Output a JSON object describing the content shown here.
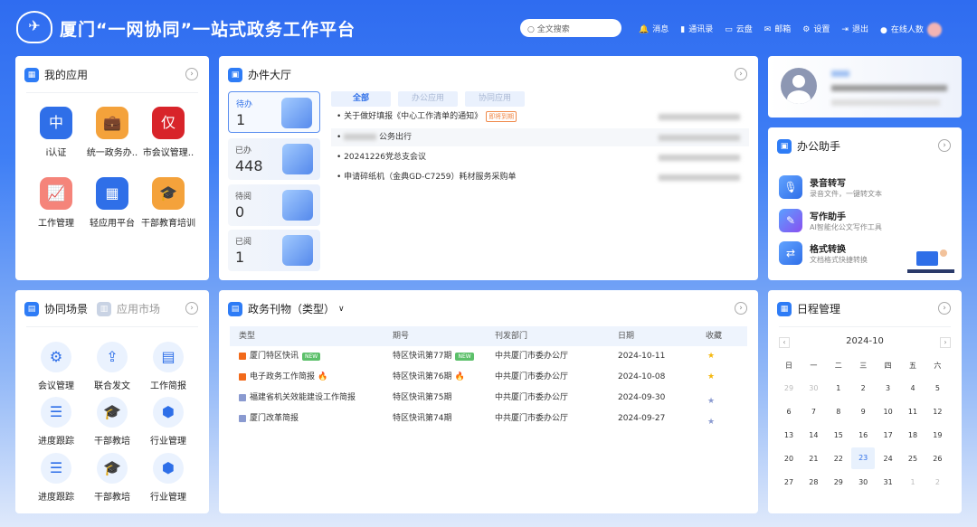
{
  "header": {
    "title": "厦门“一网协同”一站式政务工作平台",
    "search_placeholder": "全文搜索",
    "nav": [
      {
        "icon": "bell-icon",
        "label": "消息"
      },
      {
        "icon": "contacts-icon",
        "label": "通讯录"
      },
      {
        "icon": "cloud-disk-icon",
        "label": "云盘"
      },
      {
        "icon": "mail-icon",
        "label": "邮箱"
      },
      {
        "icon": "gear-icon",
        "label": "设置"
      },
      {
        "icon": "logout-icon",
        "label": "退出"
      },
      {
        "icon": "user-icon",
        "label": "在线人数"
      }
    ]
  },
  "my_apps": {
    "title": "我的应用",
    "apps": [
      {
        "label": "i认证",
        "color": "#2f6fe8"
      },
      {
        "label": "统一政务办..",
        "color": "#f4a23b"
      },
      {
        "label": "市会议管理..",
        "color": "#d8242a"
      },
      {
        "label": "工作管理",
        "color": "#f5847a"
      },
      {
        "label": "轻应用平台",
        "color": "#2f6fe8"
      },
      {
        "label": "干部教育培训",
        "color": "#f4a23b"
      }
    ]
  },
  "scenes": {
    "tabs": [
      "协同场景",
      "应用市场"
    ],
    "items": [
      "会议管理",
      "联合发文",
      "工作简报",
      "进度跟踪",
      "干部教培",
      "行业管理",
      "进度跟踪",
      "干部教培",
      "行业管理"
    ]
  },
  "hall": {
    "title": "办件大厅",
    "tiles": [
      {
        "label": "待办",
        "count": "1"
      },
      {
        "label": "已办",
        "count": "448"
      },
      {
        "label": "待阅",
        "count": "0"
      },
      {
        "label": "已阅",
        "count": "1"
      }
    ],
    "tabs": [
      "全部",
      "办公应用",
      "协同应用"
    ],
    "items": [
      {
        "text": "关于做好填报《中心工作清单的通知》",
        "tag": "即将到期"
      },
      {
        "text": "公务出行"
      },
      {
        "text": "20241226党总支会议"
      },
      {
        "text": "申请碎纸机（金典GD-C7259）耗材服务采购单"
      }
    ]
  },
  "journals": {
    "title": "政务刊物（类型）",
    "columns": [
      "类型",
      "期号",
      "刊发部门",
      "日期",
      "收藏"
    ],
    "rows": [
      {
        "type": "厦门特区快讯",
        "issue": "特区快讯第77期",
        "dept": "中共厦门市委办公厅",
        "date": "2024-10-11",
        "badge": "NEW",
        "fav": true
      },
      {
        "type": "电子政务工作简报",
        "issue": "特区快讯第76期",
        "dept": "中共厦门市委办公厅",
        "date": "2024-10-08",
        "badge": "hot",
        "fav": true
      },
      {
        "type": "福建省机关效能建设工作简报",
        "issue": "特区快讯第75期",
        "dept": "中共厦门市委办公厅",
        "date": "2024-09-30",
        "fav": false
      },
      {
        "type": "厦门改革简报",
        "issue": "特区快讯第74期",
        "dept": "中共厦门市委办公厅",
        "date": "2024-09-27",
        "fav": false
      }
    ]
  },
  "assistant": {
    "title": "办公助手",
    "tools": [
      {
        "name": "录音转写",
        "desc": "录音文件，一键转文本"
      },
      {
        "name": "写作助手",
        "desc": "AI智能化公文写作工具"
      },
      {
        "name": "格式转换",
        "desc": "文档格式快捷转换"
      }
    ]
  },
  "calendar": {
    "title": "日程管理",
    "month": "2024-10",
    "weekdays": [
      "日",
      "一",
      "二",
      "三",
      "四",
      "五",
      "六"
    ],
    "days": [
      "29",
      "30",
      "1",
      "2",
      "3",
      "4",
      "5",
      "6",
      "7",
      "8",
      "9",
      "10",
      "11",
      "12",
      "13",
      "14",
      "15",
      "16",
      "17",
      "18",
      "19",
      "20",
      "21",
      "22",
      "23",
      "24",
      "25",
      "26",
      "27",
      "28",
      "29",
      "30",
      "31",
      "1",
      "2"
    ],
    "today": "23"
  },
  "new_badge": "NEW"
}
